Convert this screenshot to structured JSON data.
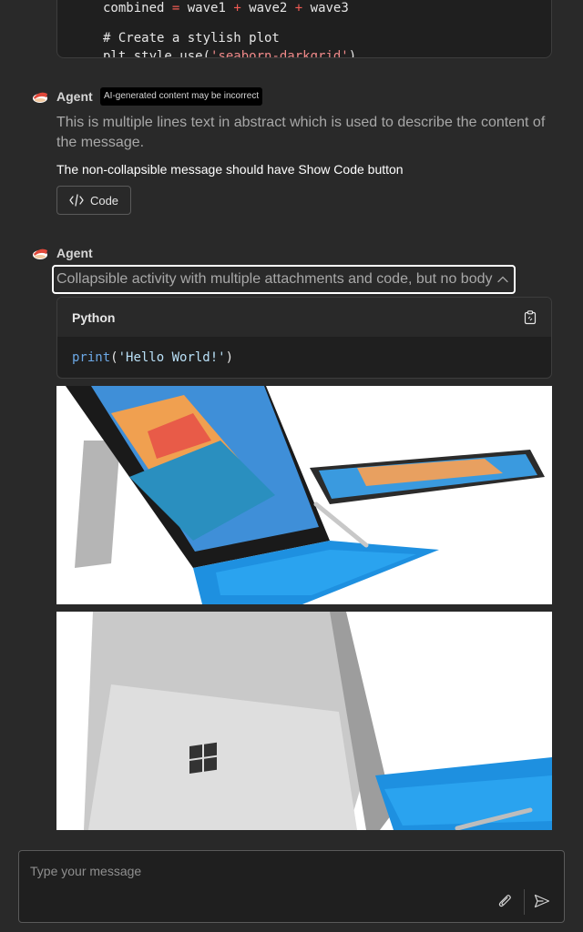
{
  "top_code": {
    "line1": {
      "a": "combined",
      "op1": " = ",
      "b": "wave1",
      "op2": " + ",
      "c": "wave2",
      "op3": " + ",
      "d": "wave3"
    },
    "line2": "# Create a stylish plot",
    "line3": {
      "pre": "plt.style.use(",
      "str": "'seaborn-darkgrid'",
      "post": ")"
    }
  },
  "message1": {
    "agent_name": "Agent",
    "badge": "AI-generated content may be incorrect",
    "abstract": "This is multiple lines text in abstract which is used to describe the content of the message.",
    "body": "The non-collapsible message should have Show Code button",
    "code_button_label": "Code"
  },
  "message2": {
    "agent_name": "Agent",
    "collapsible_title": "Collapsible activity with multiple attachments and code, but no body",
    "code_block": {
      "language": "Python",
      "fn": "print",
      "open": "(",
      "str": "'Hello World!'",
      "close": ")"
    }
  },
  "composer": {
    "placeholder": "Type your message"
  },
  "colors": {
    "background": "#292929",
    "code_bg": "#1f1f1f",
    "string": "#b9e0f7",
    "function": "#6ca8e6",
    "operator": "#f25c54",
    "surface_blue": "#1e90e0"
  },
  "icons": [
    "agent-avatar-icon",
    "code-icon",
    "chevron-up-icon",
    "copy-icon",
    "attach-icon",
    "send-icon"
  ]
}
